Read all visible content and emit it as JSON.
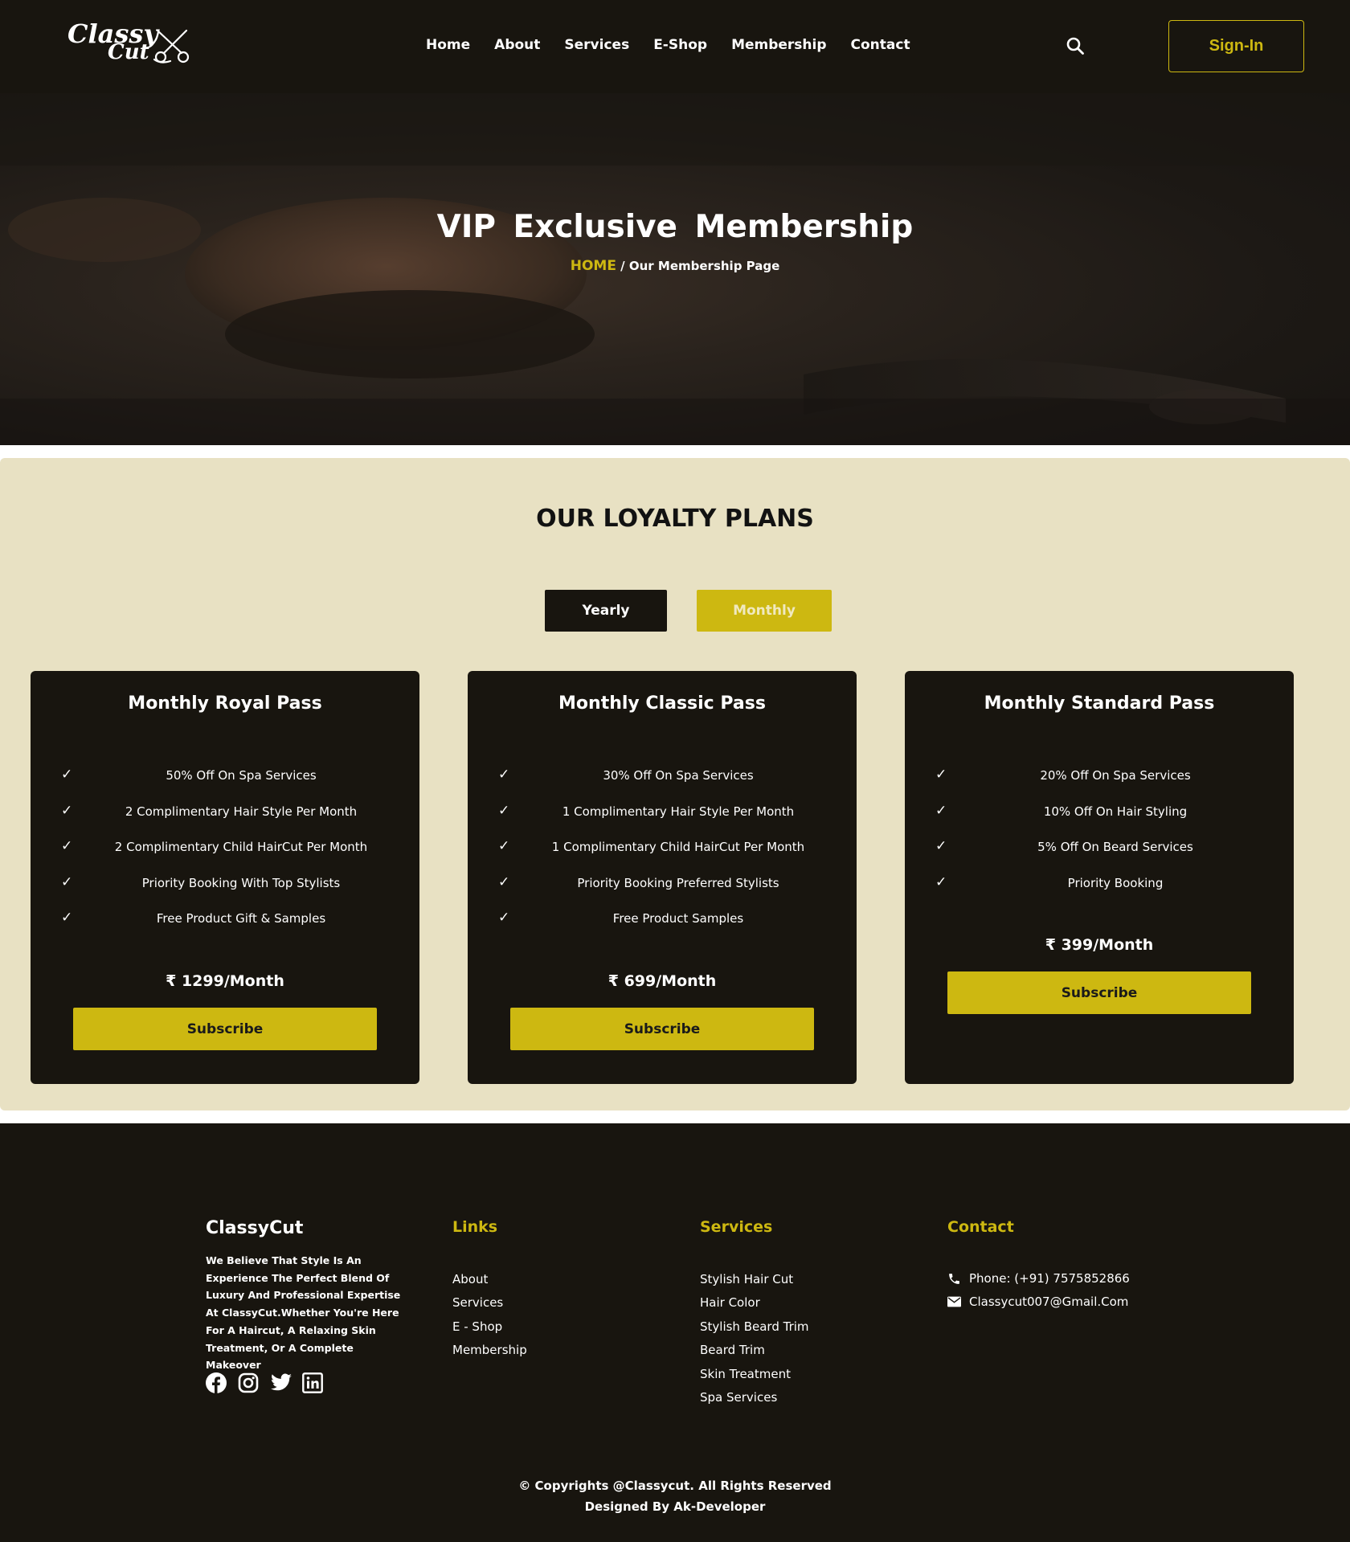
{
  "header": {
    "logo_line1": "Classy",
    "logo_line2": "Cut",
    "nav": [
      "Home",
      "About",
      "Services",
      "E-Shop",
      "Membership",
      "Contact"
    ],
    "signin_label": "Sign-In"
  },
  "hero": {
    "title": "VIP Exclusive Membership",
    "breadcrumb_home": "HOME",
    "breadcrumb_rest": " / Our Membership Page"
  },
  "plans": {
    "title": "OUR LOYALTY PLANS",
    "toggle_yearly": "Yearly",
    "toggle_monthly": "Monthly",
    "check": "✓",
    "subscribe_label": "Subscribe",
    "cards": [
      {
        "title": "Monthly Royal Pass",
        "features": [
          "50% Off On Spa Services",
          "2 Complimentary Hair Style Per Month",
          "2 Complimentary Child HairCut Per Month",
          "Priority Booking With Top Stylists",
          "Free Product Gift & Samples"
        ],
        "price": "₹ 1299/Month"
      },
      {
        "title": "Monthly Classic Pass",
        "features": [
          "30% Off On Spa Services",
          "1 Complimentary Hair Style Per Month",
          "1 Complimentary Child HairCut Per Month",
          "Priority Booking Preferred Stylists",
          "Free Product Samples"
        ],
        "price": "₹ 699/Month"
      },
      {
        "title": "Monthly Standard Pass",
        "features": [
          "20% Off On Spa Services",
          "10% Off On Hair Styling",
          "5% Off On Beard Services",
          "Priority Booking"
        ],
        "price": "₹ 399/Month"
      }
    ]
  },
  "footer": {
    "brand": "ClassyCut",
    "description": "We Believe That Style Is An Experience The Perfect Blend Of Luxury And Professional Expertise At ClassyCut.Whether You're Here For A Haircut, A Relaxing Skin Treatment, Or A Complete Makeover",
    "links_heading": "Links",
    "links": [
      "About",
      "Services",
      "E - Shop",
      "Membership"
    ],
    "services_heading": "Services",
    "services": [
      "Stylish Hair Cut",
      "Hair Color",
      "Stylish Beard Trim",
      "Beard Trim",
      "Skin Treatment",
      "Spa Services"
    ],
    "contact_heading": "Contact",
    "phone": "Phone: (+91) 7575852866",
    "email": "Classycut007@Gmail.Com",
    "copyright": "© Copyrights @Classycut. All Rights Reserved",
    "designed_by": "Designed By Ak-Developer"
  },
  "colors": {
    "accent": "#cdb811",
    "dark": "#18150f",
    "plans_bg": "#e8e1c3"
  },
  "icons": [
    "search-icon",
    "scissors-icon",
    "facebook-icon",
    "instagram-icon",
    "twitter-icon",
    "linkedin-icon",
    "phone-icon",
    "mail-icon"
  ]
}
